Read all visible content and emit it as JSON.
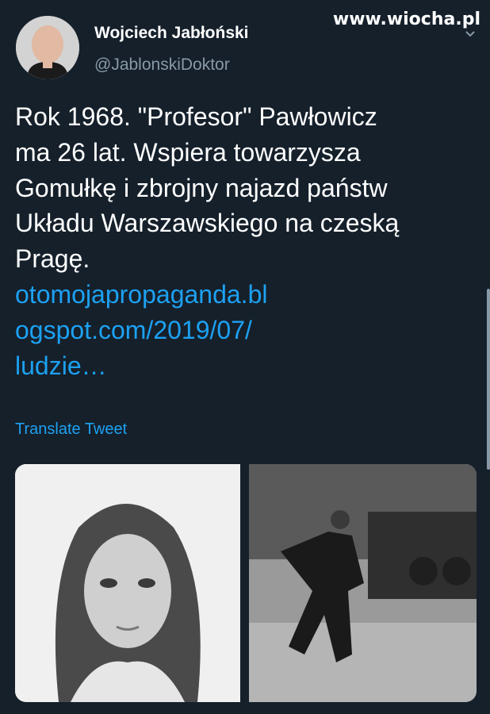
{
  "watermark": "www.wiocha.pl",
  "author": {
    "display_name": "Wojciech Jabłoński",
    "handle": "@JablonskiDoktor",
    "avatar_icon": "user-avatar"
  },
  "tweet": {
    "text": "Rok 1968. \"Profesor\" Pawłowicz\nma 26 lat. Wspiera towarzysza\nGomułkę i zbrojny najazd państw\nUkładu Warszawskiego na czeską\nPragę.",
    "link_text": "otomojapropaganda.bl\nogspot.com/2019/07/\nludzie…",
    "translate_label": "Translate Tweet"
  },
  "media": {
    "left_image": "portrait-photo",
    "right_image": "street-protest-photo"
  },
  "colors": {
    "background": "#15202b",
    "link": "#1da1f2",
    "secondary_text": "#8899a6"
  },
  "icons": {
    "menu": "chevron-down-icon"
  }
}
